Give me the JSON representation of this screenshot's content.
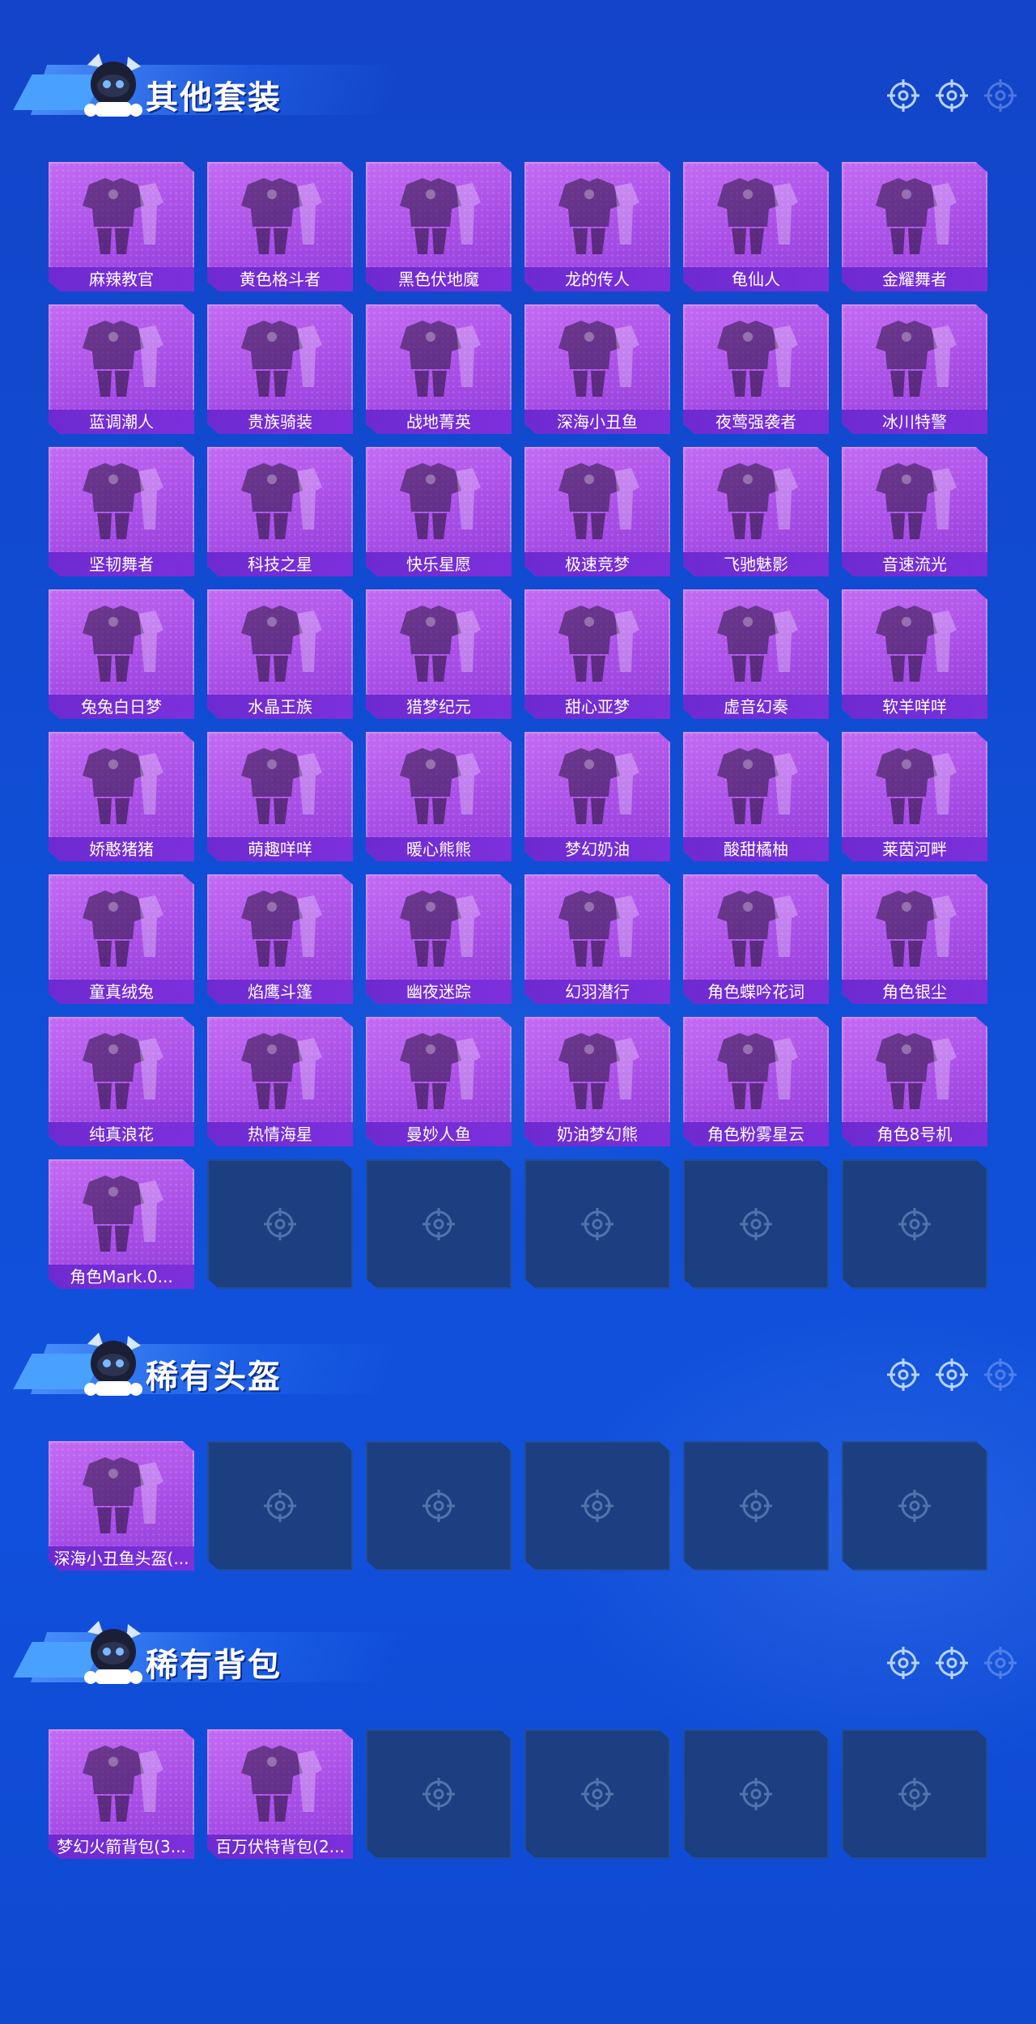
{
  "colors": {
    "background": "#1344c9",
    "card_filled": "#b05ae8",
    "card_label": "#7430d6",
    "card_empty": "#1b3f80",
    "icon": "#b8d4ff"
  },
  "sections": [
    {
      "title": "其他套装",
      "items": [
        "麻辣教官",
        "黄色格斗者",
        "黑色伏地魔",
        "龙的传人",
        "龟仙人",
        "金耀舞者",
        "蓝调潮人",
        "贵族骑装",
        "战地菁英",
        "深海小丑鱼",
        "夜莺强袭者",
        "冰川特警",
        "坚韧舞者",
        "科技之星",
        "快乐星愿",
        "极速竞梦",
        "飞驰魅影",
        "音速流光",
        "兔兔白日梦",
        "水晶王族",
        "猎梦纪元",
        "甜心亚梦",
        "虚音幻奏",
        "软羊咩咩",
        "娇憨猪猪",
        "萌趣咩咩",
        "暖心熊熊",
        "梦幻奶油",
        "酸甜橘柚",
        "莱茵河畔",
        "童真绒兔",
        "焰鹰斗篷",
        "幽夜迷踪",
        "幻羽潜行",
        "角色蝶吟花词",
        "角色银尘",
        "纯真浪花",
        "热情海星",
        "曼妙人鱼",
        "奶油梦幻熊",
        "角色粉雾星云",
        "角色8号机",
        "角色Mark.0..."
      ],
      "empty_slots": 5
    },
    {
      "title": "稀有头盔",
      "items": [
        "深海小丑鱼头盔(..."
      ],
      "empty_slots": 5
    },
    {
      "title": "稀有背包",
      "items": [
        "梦幻火箭背包(3...",
        "百万伏特背包(2..."
      ],
      "empty_slots": 4
    }
  ]
}
